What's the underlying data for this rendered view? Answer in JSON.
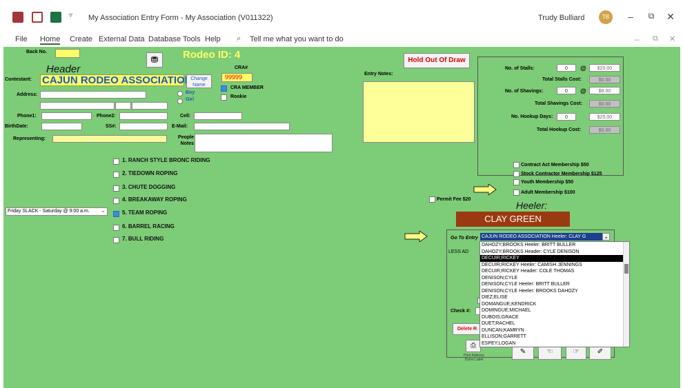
{
  "window": {
    "title": "My Association Entry Form  -  My Association (V011322)",
    "user_name": "Trudy Bulliard",
    "user_initials": "TB"
  },
  "menu": [
    "File",
    "Home",
    "Create",
    "External Data",
    "Database Tools",
    "Help"
  ],
  "tell_me": "Tell me what you want to do",
  "form": {
    "back_no_label": "Back No.",
    "back_no_value": "",
    "rodeo_id": "Rodeo ID:  4",
    "header_role": "Header",
    "contestant_label": "Contestant:",
    "contestant_value": "CAJUN RODEO ASSOCIATION",
    "change_name_button": "Change Name",
    "cra_label": "CRA#",
    "cra_value": "99999",
    "cra_member_label": "CRA MEMBER",
    "rookie_label": "Rookie",
    "boy_label": "Boy",
    "girl_label": "Girl",
    "address_label": "Address:",
    "phone1_label": "Phone1:",
    "phone2_label": "Phone2:",
    "cell_label": "Cell:",
    "birthdate_label": "BirthDate:",
    "ss_label": "SS#:",
    "email_label": "E-Mail:",
    "representing_label": "Representing:",
    "people_notes_label": "People Notes",
    "events": [
      {
        "label": "1.  RANCH STYLE BRONC RIDING",
        "checked": false
      },
      {
        "label": "2.  TIEDOWN ROPING",
        "checked": false
      },
      {
        "label": "3.  CHUTE DOGGING",
        "checked": false
      },
      {
        "label": "4.  BREAKAWAY ROPING",
        "checked": false
      },
      {
        "label": "5.  TEAM ROPING",
        "checked": true
      },
      {
        "label": "6.  BARREL RACING",
        "checked": false
      },
      {
        "label": "7.  BULL RIDING",
        "checked": false
      }
    ],
    "slack_select": "Friday SLACK - Saturday @ 9:00 a.m.",
    "hold_out_button": "Hold Out Of Draw",
    "entry_notes_label": "Entry Notes:",
    "stalls_label": "No. of Stalls:",
    "stalls_value": "0",
    "stalls_price": "$20.00",
    "total_stalls_label": "Total Stalls Cost:",
    "total_stalls_value": "$0.00",
    "shavings_label": "No. of Shavings:",
    "shavings_value": "0",
    "shavings_price": "$8.00",
    "total_shavings_label": "Total Shavings Cost:",
    "total_shavings_value": "$0.00",
    "hookup_label": "No. Hookup Days:",
    "hookup_value": "0",
    "hookup_price": "$25.00",
    "total_hookup_label": "Total Hookup Cost:",
    "total_hookup_value": "$0.00",
    "at_symbol": "@",
    "memberships": [
      {
        "label": "Contract Act Membership $50"
      },
      {
        "label": "Stock Contractor Membership $125"
      },
      {
        "label": "Youth Membership $50"
      },
      {
        "label": "Adult Membership $100"
      }
    ],
    "permit_fee_label": "Permit Fee $20",
    "heeler_role": "Heeler:",
    "heeler_name": "CLAY GREEN",
    "go_to_entry_label": "Go To Entry",
    "go_to_entry_value": "CAJUN RODEO ASSOCIATION   Heeler: CLAY G",
    "less_label": "LESS AD",
    "check_label": "Check #:",
    "delete_button": "Delete R",
    "print_label": "Print Address Dymo Label",
    "dropdown_items": [
      "DAHOZY;BROOKS    Heeler: BRITT BULLER",
      "DAHOZY;BROOKS    Header: CYLE DENISON",
      "DECUIR;RICKEY",
      "DECUIR;RICKEY    Heeler: CAMISH JENNINGS",
      "DECUIR;RICKEY    Header: COLE THOMAS",
      "DENISON;CYLE",
      "DENISON;CYLE    Heeler: BRITT BULLER",
      "DENISON;CYLE    Heeler: BROOKS DAHOZY",
      "DIEZ;ELISE",
      "DOMANGUE;KENDRICK",
      "DOMINGUE;MICHAEL",
      "DUBOIS;GRACE",
      "DUET;RACHEL",
      "DUNCAN;KAMRYN",
      "ELLISON;GARRETT",
      "ESPEY;LOGAN"
    ],
    "dropdown_selected_index": 2
  },
  "colors": {
    "form_bg": "#7dcc77",
    "yellow_field": "#ffff66",
    "heeler_bar": "#9b3a10",
    "title_red": "#e00000"
  }
}
